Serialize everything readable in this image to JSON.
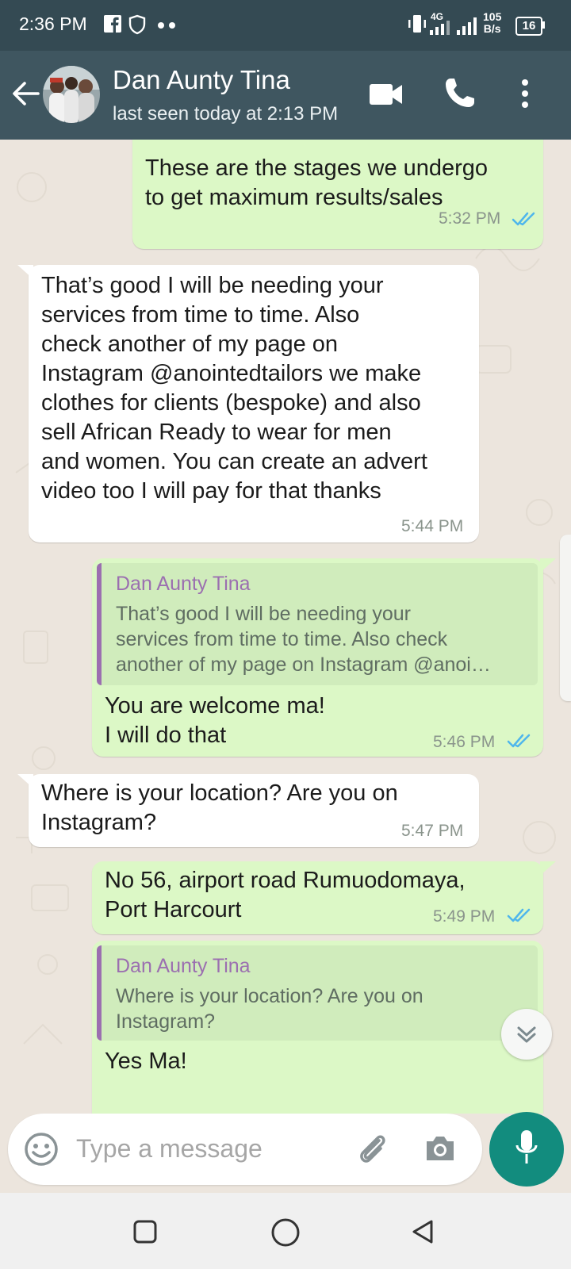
{
  "status_bar": {
    "time": "2:36 PM",
    "network": "4G",
    "speed_value": "105",
    "speed_unit": "B/s",
    "battery": "16"
  },
  "header": {
    "contact_name": "Dan Aunty Tina",
    "last_seen": "last seen today at 2:13 PM"
  },
  "messages": [
    {
      "direction": "out",
      "text": "These are the stages we undergo\nto get maximum results/sales",
      "time": "5:32 PM",
      "status": "read"
    },
    {
      "direction": "in",
      "text": "That’s good I will be needing your\nservices from time to time. Also\ncheck another of my page on\nInstagram @anointedtailors we make\nclothes for clients (bespoke) and also\nsell African Ready to wear for men\nand women. You can create an advert\nvideo too I will pay for that thanks",
      "time": "5:44 PM"
    },
    {
      "direction": "out",
      "quote": {
        "name": "Dan Aunty Tina",
        "text": "That’s good I will be needing your\nservices from time to time. Also check\nanother of my page on Instagram @anoi…"
      },
      "text": "You are welcome ma!\nI will do that",
      "time": "5:46 PM",
      "status": "read"
    },
    {
      "direction": "in",
      "text": "Where is your location? Are you on\nInstagram?",
      "time": "5:47 PM"
    },
    {
      "direction": "out",
      "text": "No 56, airport road Rumuodomaya,\nPort Harcourt",
      "time": "5:49 PM",
      "status": "read"
    },
    {
      "direction": "out",
      "quote": {
        "name": "Dan Aunty Tina",
        "text": "Where is your location? Are you on\nInstagram?"
      },
      "text": "Yes Ma!"
    }
  ],
  "composer": {
    "placeholder": "Type a message"
  },
  "colors": {
    "header": "#3f5660",
    "status_bar": "#344a53",
    "outgoing_bubble": "#dcf8c6",
    "incoming_bubble": "#ffffff",
    "read_tick": "#4fb6ec",
    "mic_button": "#128c7e",
    "quote_accent": "#9b6fb0"
  },
  "icons": {
    "back": "arrow-left-icon",
    "video": "video-call-icon",
    "call": "phone-icon",
    "menu": "more-vert-icon",
    "emoji": "emoji-icon",
    "attach": "paperclip-icon",
    "camera": "camera-icon",
    "mic": "mic-icon",
    "scroll_down": "double-chevron-down-icon"
  }
}
